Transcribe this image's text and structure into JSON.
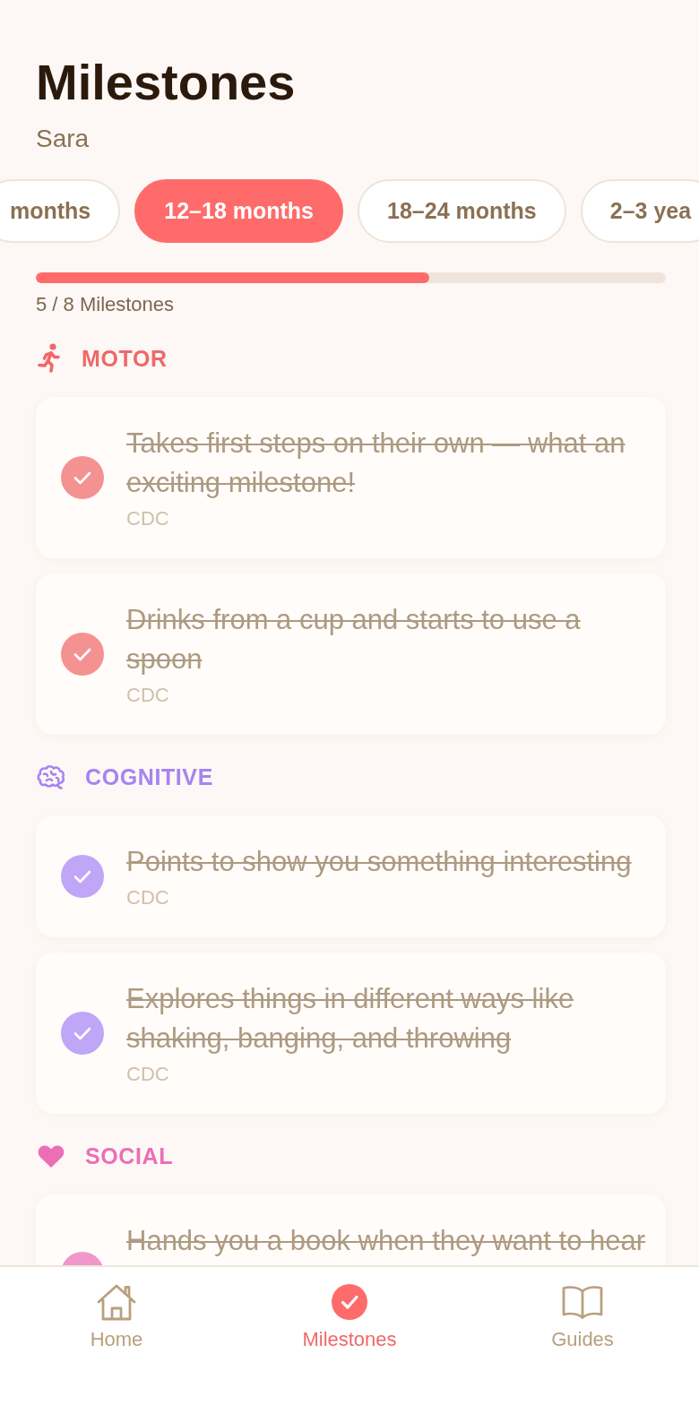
{
  "title": "Milestones",
  "child_name": "Sara",
  "age_tabs": [
    {
      "label": "months",
      "selected": false
    },
    {
      "label": "12–18 months",
      "selected": true
    },
    {
      "label": "18–24 months",
      "selected": false
    },
    {
      "label": "2–3 yea",
      "selected": false
    }
  ],
  "progress": {
    "level": 0.625,
    "label": "5 / 8 Milestones"
  },
  "sections": [
    {
      "kind": "motor",
      "title": "MOTOR",
      "color": "#f06868",
      "milestones": [
        {
          "text": "Takes first steps on their own — what an exciting milestone!",
          "source": "CDC",
          "checked": true
        },
        {
          "text": "Drinks from a cup and starts to use a spoon",
          "source": "CDC",
          "checked": true
        }
      ]
    },
    {
      "kind": "cognitive",
      "title": "COGNITIVE",
      "color": "#a684f2",
      "milestones": [
        {
          "text": "Points to show you something interesting",
          "source": "CDC",
          "checked": true
        },
        {
          "text": "Explores things in different ways like shaking, banging, and throwing",
          "source": "CDC",
          "checked": true
        }
      ]
    },
    {
      "kind": "social",
      "title": "SOCIAL",
      "color": "#eb6fb7",
      "milestones": [
        {
          "text": "Hands you a book when they want to hear",
          "checked": true
        }
      ]
    }
  ],
  "nav": [
    {
      "kind": "home",
      "label": "Home",
      "selected": false
    },
    {
      "kind": "milestones",
      "label": "Milestones",
      "selected": true
    },
    {
      "kind": "guides",
      "label": "Guides",
      "selected": false
    }
  ]
}
